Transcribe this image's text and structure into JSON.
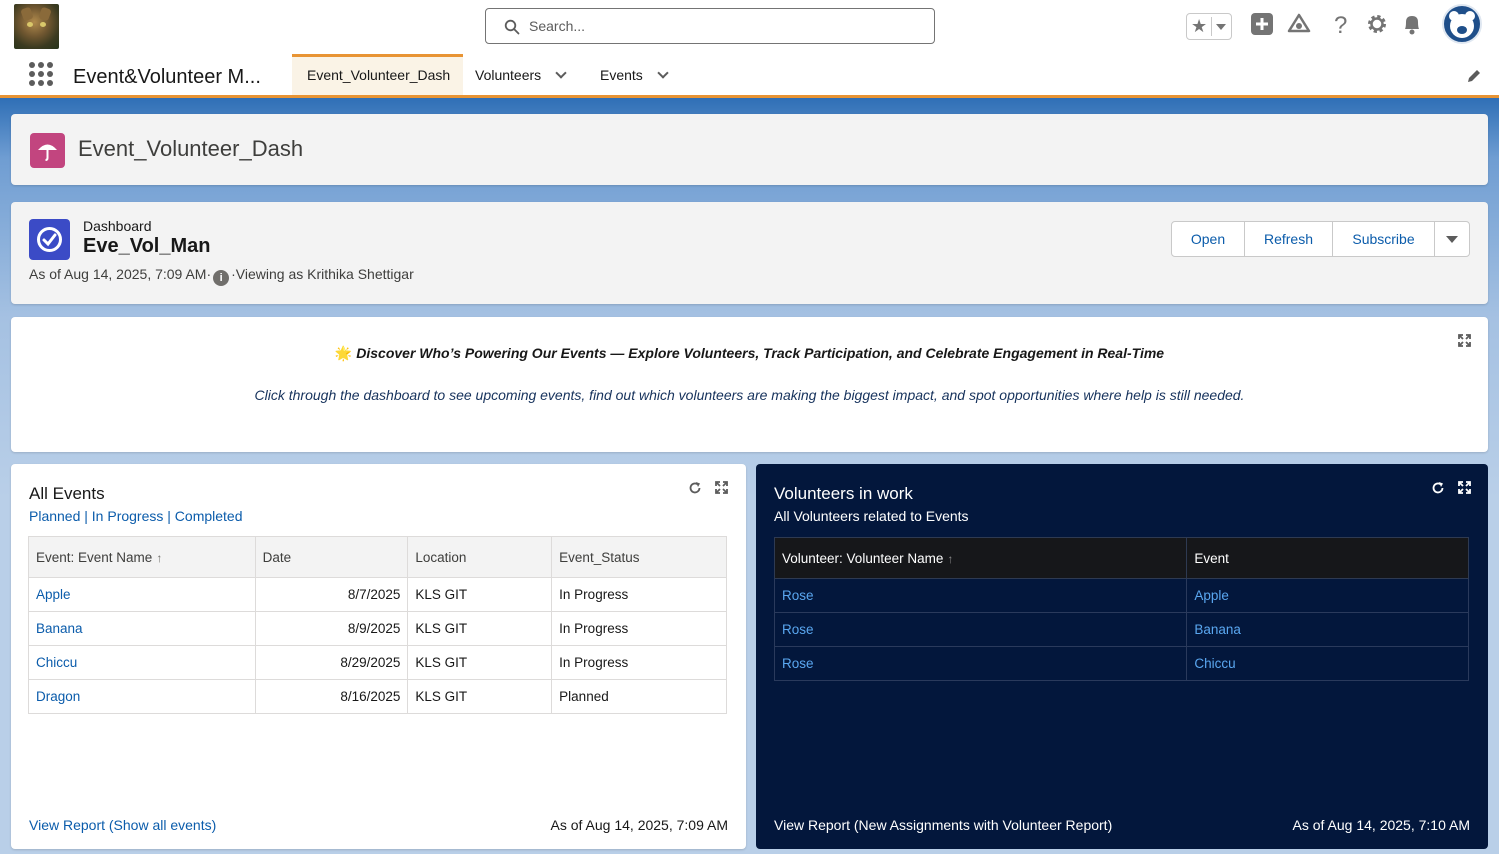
{
  "search": {
    "placeholder": "Search..."
  },
  "app": {
    "name": "Event&Volunteer M...",
    "tabs": [
      {
        "label": "Event_Volunteer_Dash",
        "active": true
      },
      {
        "label": "Volunteers"
      },
      {
        "label": "Events"
      }
    ]
  },
  "page": {
    "title": "Event_Volunteer_Dash"
  },
  "dashboard": {
    "label": "Dashboard",
    "name": "Eve_Vol_Man",
    "as_of": "As of Aug 14, 2025, 7:09 AM·",
    "viewing": "·Viewing as Krithika Shettigar",
    "buttons": {
      "open": "Open",
      "refresh": "Refresh",
      "subscribe": "Subscribe"
    }
  },
  "banner": {
    "emoji": "🌟",
    "heading": "Discover Who’s Powering Our Events — Explore Volunteers, Track Participation, and Celebrate Engagement in Real-Time",
    "subtext": "Click through the dashboard to see upcoming events, find out which volunteers are making the biggest impact, and spot opportunities where help is still needed."
  },
  "all_events": {
    "title": "All Events",
    "subtitle": "Planned | In Progress | Completed",
    "columns": [
      "Event: Event Name",
      "Date",
      "Location",
      "Event_Status"
    ],
    "rows": [
      [
        "Apple",
        "8/7/2025",
        "KLS GIT",
        "In Progress"
      ],
      [
        "Banana",
        "8/9/2025",
        "KLS GIT",
        "In Progress"
      ],
      [
        "Chiccu",
        "8/29/2025",
        "KLS GIT",
        "In Progress"
      ],
      [
        "Dragon",
        "8/16/2025",
        "KLS GIT",
        "Planned"
      ]
    ],
    "footer_link": "View Report (Show all events)",
    "footer_time": "As of Aug 14, 2025, 7:09 AM"
  },
  "volunteers": {
    "title": "Volunteers in work",
    "subtitle": "All Volunteers related to Events",
    "columns": [
      "Volunteer: Volunteer Name",
      "Event"
    ],
    "rows": [
      [
        "Rose",
        "Apple"
      ],
      [
        "Rose",
        "Banana"
      ],
      [
        "Rose",
        "Chiccu"
      ]
    ],
    "footer_link": "View Report (New Assignments with Volunteer Report)",
    "footer_time": "As of Aug 14, 2025, 7:10 AM"
  },
  "colors": {
    "brand_blue": "#0b5cab",
    "accent_orange": "#e89434",
    "dark_widget": "#03173c",
    "title_icon": "#c2457f",
    "dashboard_icon": "#3b4bc6"
  },
  "icons": [
    "search-icon",
    "star-icon",
    "add-icon",
    "trailhead-icon",
    "help-icon",
    "gear-icon",
    "bell-icon",
    "app-launcher-icon",
    "chevron-down-icon",
    "pencil-icon",
    "umbrella-icon",
    "dashboard-gauge-icon",
    "info-icon",
    "expand-icon",
    "refresh-icon"
  ]
}
